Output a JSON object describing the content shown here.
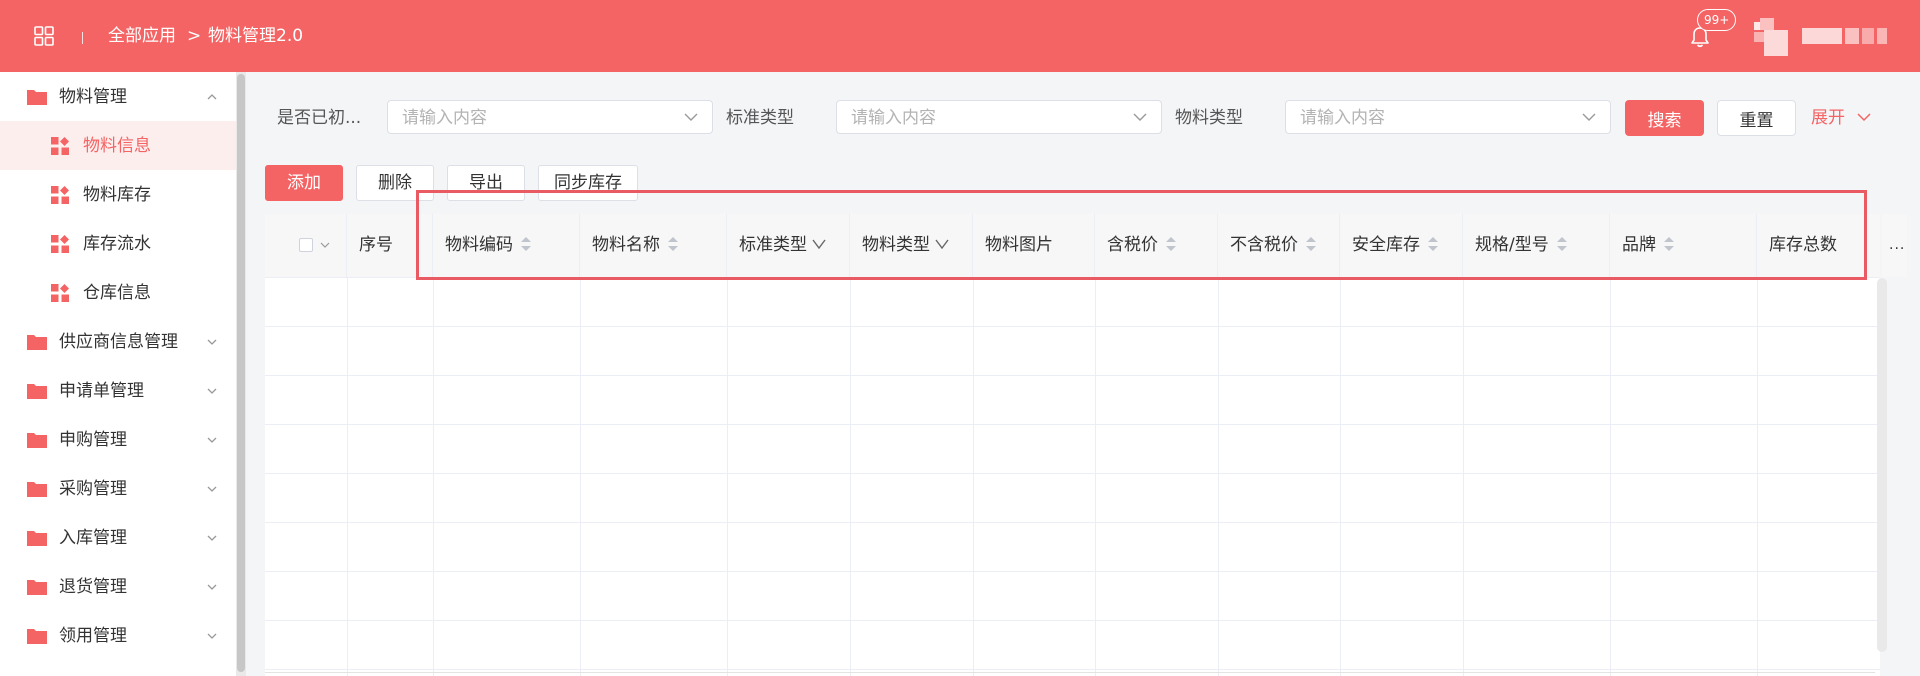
{
  "header": {
    "breadcrumb_root": "全部应用",
    "breadcrumb_separator": ">",
    "breadcrumb_current": "物料管理2.0",
    "notification_badge": "99+",
    "accent_color": "#f46464"
  },
  "sidebar": {
    "items": [
      {
        "label": "物料管理",
        "level": 1,
        "icon": "folder-icon",
        "expanded": true
      },
      {
        "label": "物料信息",
        "level": 2,
        "icon": "grid-icon",
        "active": true
      },
      {
        "label": "物料库存",
        "level": 2,
        "icon": "grid-icon"
      },
      {
        "label": "库存流水",
        "level": 2,
        "icon": "grid-icon"
      },
      {
        "label": "仓库信息",
        "level": 2,
        "icon": "grid-icon"
      },
      {
        "label": "供应商信息管理",
        "level": 1,
        "icon": "folder-icon"
      },
      {
        "label": "申请单管理",
        "level": 1,
        "icon": "folder-icon"
      },
      {
        "label": "申购管理",
        "level": 1,
        "icon": "folder-icon"
      },
      {
        "label": "采购管理",
        "level": 1,
        "icon": "folder-icon"
      },
      {
        "label": "入库管理",
        "level": 1,
        "icon": "folder-icon"
      },
      {
        "label": "退货管理",
        "level": 1,
        "icon": "folder-icon"
      },
      {
        "label": "领用管理",
        "level": 1,
        "icon": "folder-icon"
      }
    ]
  },
  "filters": [
    {
      "label": "是否已初...",
      "placeholder": "请输入内容"
    },
    {
      "label": "标准类型",
      "placeholder": "请输入内容"
    },
    {
      "label": "物料类型",
      "placeholder": "请输入内容"
    }
  ],
  "filter_actions": {
    "search": "搜索",
    "reset": "重置",
    "expand": "展开"
  },
  "actions": {
    "add": "添加",
    "delete": "删除",
    "export": "导出",
    "sync": "同步库存"
  },
  "table": {
    "columns": [
      {
        "label": "序号",
        "sortable": false,
        "filter": false
      },
      {
        "label": "物料编码",
        "sortable": true,
        "filter": false
      },
      {
        "label": "物料名称",
        "sortable": true,
        "filter": false
      },
      {
        "label": "标准类型",
        "sortable": false,
        "filter": true
      },
      {
        "label": "物料类型",
        "sortable": false,
        "filter": true
      },
      {
        "label": "物料图片",
        "sortable": false,
        "filter": false
      },
      {
        "label": "含税价",
        "sortable": true,
        "filter": false
      },
      {
        "label": "不含税价",
        "sortable": true,
        "filter": false
      },
      {
        "label": "安全库存",
        "sortable": true,
        "filter": false
      },
      {
        "label": "规格/型号",
        "sortable": true,
        "filter": false
      },
      {
        "label": "品牌",
        "sortable": true,
        "filter": false
      },
      {
        "label": "库存总数",
        "sortable": false,
        "filter": false
      }
    ],
    "more_label": "..."
  }
}
